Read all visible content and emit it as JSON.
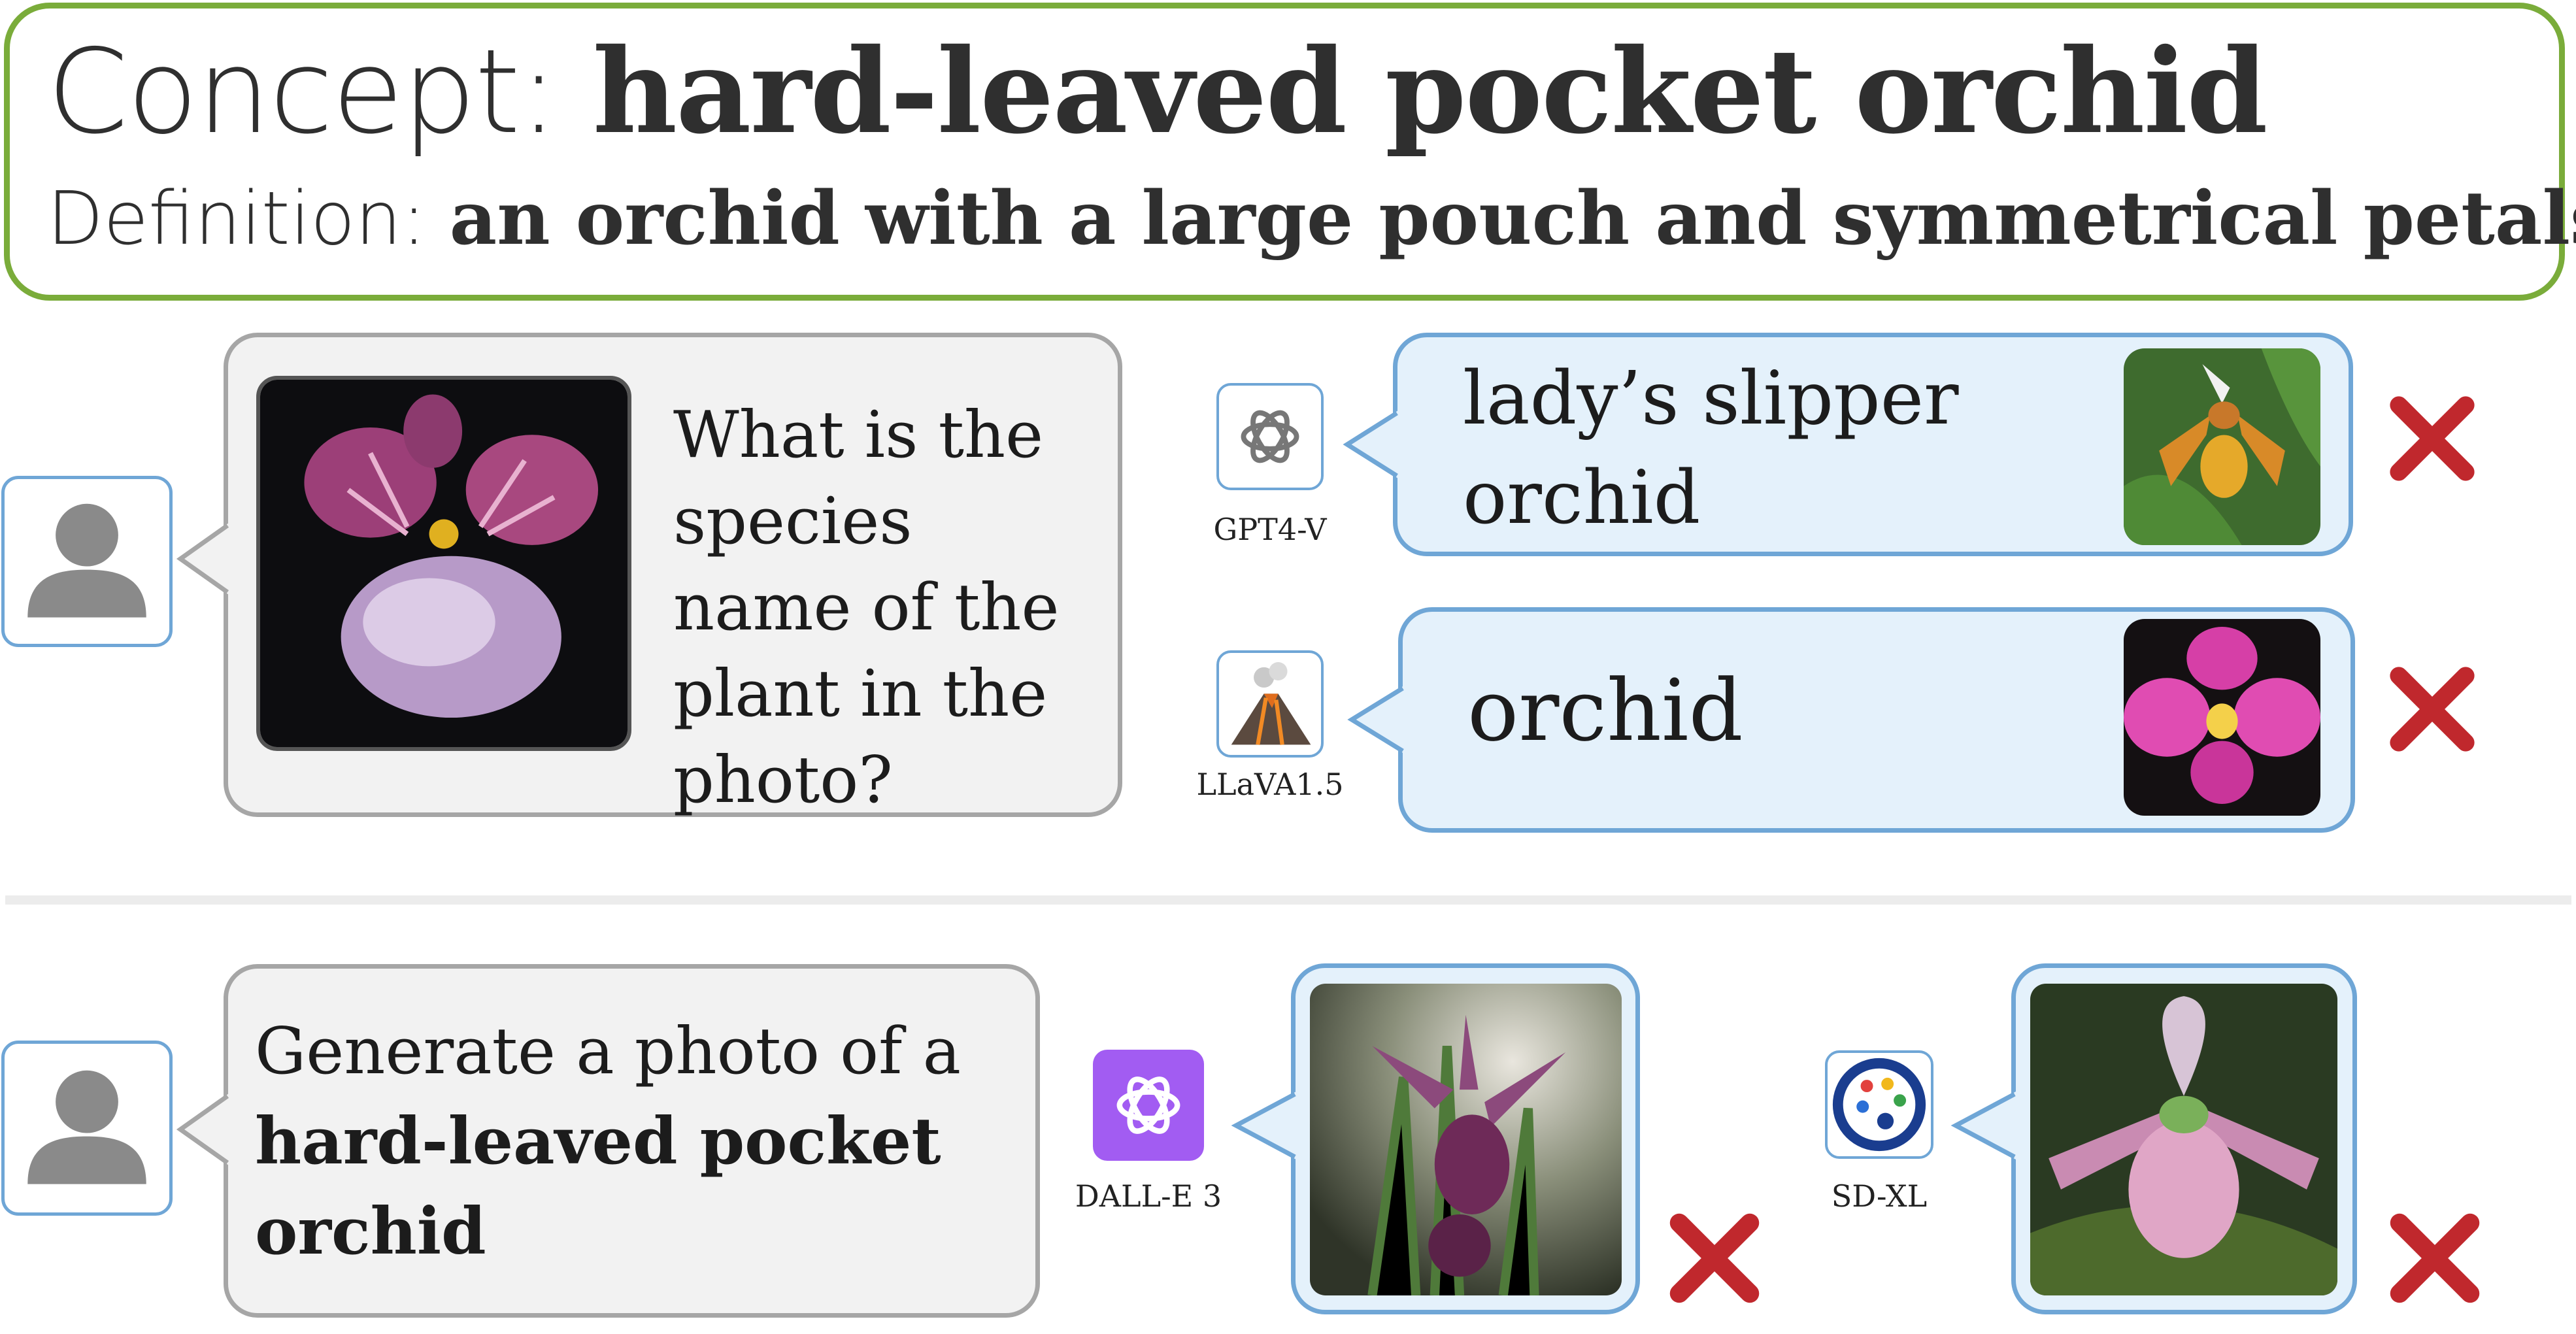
{
  "concept": {
    "label": "Concept: ",
    "name": "hard-leaved pocket orchid",
    "definition_label": "Definition: ",
    "definition": "an orchid with a large pouch and symmetrical petals."
  },
  "recognition": {
    "question": "What is the species name of the plant in the photo?",
    "responses": [
      {
        "model": "GPT4-V",
        "answer": "lady’s slipper orchid",
        "result": "incorrect"
      },
      {
        "model": "LLaVA1.5",
        "answer": "orchid",
        "result": "incorrect"
      }
    ]
  },
  "generation": {
    "prompt_prefix": "Generate a photo of a ",
    "prompt_concept": "hard-leaved pocket orchid",
    "responses": [
      {
        "model": "DALL-E 3",
        "result": "incorrect"
      },
      {
        "model": "SD-XL",
        "result": "incorrect"
      }
    ]
  },
  "colors": {
    "concept_border": "#7aac3a",
    "bubble_blue_fill": "#e4f1fb",
    "bubble_blue_border": "#6fa6d6",
    "bubble_gray_fill": "#f2f2f2",
    "bubble_gray_border": "#a6a6a6",
    "cross": "#c0282d"
  },
  "icons": {
    "user": "user-silhouette-icon",
    "gpt4v": "openai-logo-icon",
    "llava": "volcano-icon",
    "dalle": "openai-logo-icon",
    "sdxl": "palette-icon",
    "result": "red-cross-icon"
  }
}
